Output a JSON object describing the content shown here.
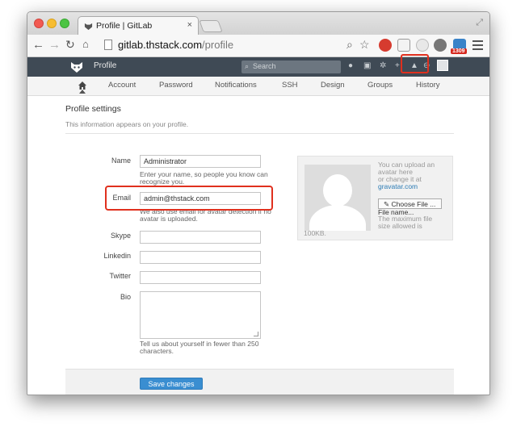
{
  "browser": {
    "tab_title": "Profile | GitLab",
    "tab_close": "×",
    "url_host": "gitlab.thstack.com",
    "url_path": "/profile",
    "ext_badge": "1309"
  },
  "gitlab": {
    "title": "Profile",
    "search_placeholder": "Search"
  },
  "subnav": {
    "items": [
      "Account",
      "Password",
      "Notifications",
      "SSH",
      "Design",
      "Groups",
      "History"
    ]
  },
  "page": {
    "title": "Profile settings",
    "subtitle": "This information appears on your profile."
  },
  "form": {
    "name_label": "Name",
    "name_value": "Administrator",
    "name_help_1": "Enter your name, so people you know can",
    "name_help_2": "recognize you.",
    "email_label": "Email",
    "email_value": "admin@thstack.com",
    "email_help_1": "We also use email for avatar detection if no",
    "email_help_2": "avatar is uploaded.",
    "skype_label": "Skype",
    "linkedin_label": "Linkedin",
    "twitter_label": "Twitter",
    "bio_label": "Bio",
    "bio_help_1": "Tell us about yourself in fewer than 250",
    "bio_help_2": "characters.",
    "save_label": "Save changes"
  },
  "avatar": {
    "text_1": "You can upload an",
    "text_2": "avatar here",
    "text_3": "or change it at",
    "link": "gravatar.com",
    "choose_label": "Choose File ...",
    "filename": "File name...",
    "max_1": "The maximum file",
    "max_2": "size allowed is",
    "max_3": "100KB."
  },
  "colors": {
    "header_bg": "#3f4a55",
    "primary_button": "#3a8ed1",
    "highlight": "#e0301e",
    "link": "#2a7ab4"
  }
}
